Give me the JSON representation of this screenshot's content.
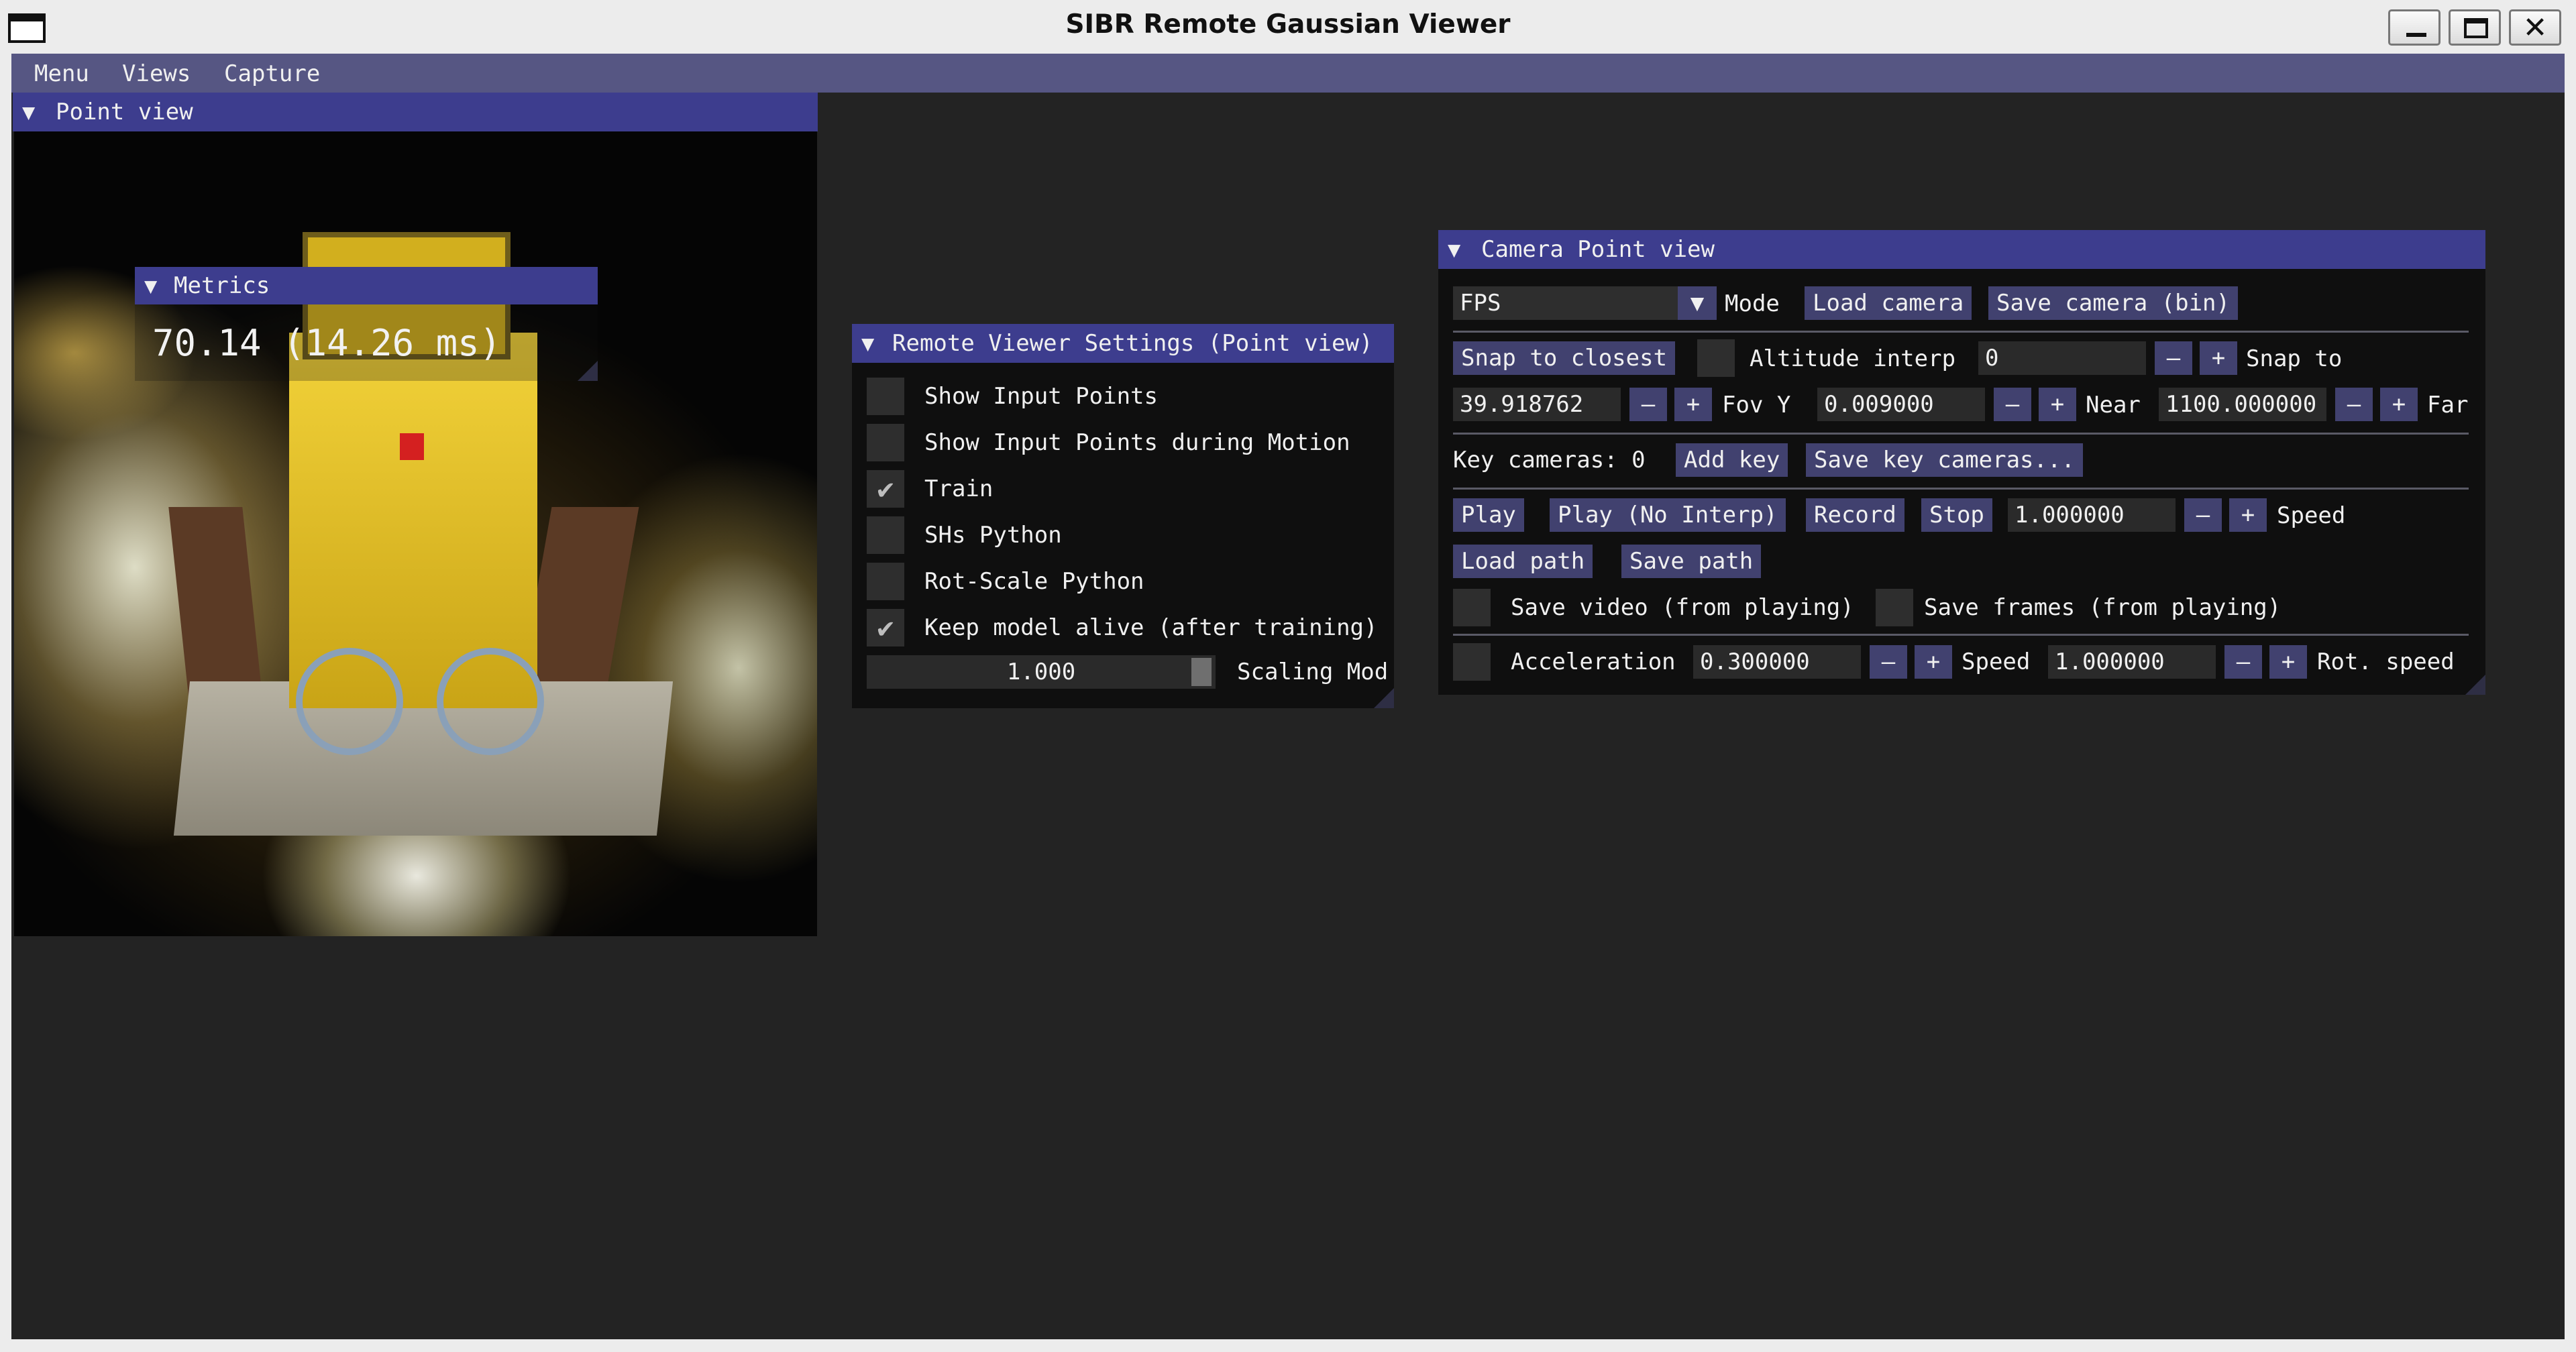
{
  "window": {
    "title": "SIBR Remote Gaussian Viewer"
  },
  "menubar": [
    "Menu",
    "Views",
    "Capture"
  ],
  "point_view": {
    "title": "Point view",
    "metrics": {
      "title": "Metrics",
      "value": "70.14 (14.26 ms)"
    }
  },
  "remote_settings": {
    "title": "Remote Viewer Settings (Point view)",
    "options": [
      {
        "label": "Show Input Points",
        "checked": false
      },
      {
        "label": "Show Input Points during Motion",
        "checked": false
      },
      {
        "label": "Train",
        "checked": true
      },
      {
        "label": "SHs Python",
        "checked": false
      },
      {
        "label": "Rot-Scale Python",
        "checked": false
      },
      {
        "label": "Keep model alive (after training)",
        "checked": true
      }
    ],
    "check_glyph": "✔",
    "scaling": {
      "value": "1.000",
      "label": "Scaling Mod",
      "fraction": 0.0
    }
  },
  "camera": {
    "title": "Camera Point view",
    "mode_value": "FPS",
    "mode_label": "Mode",
    "load_camera": "Load camera",
    "save_camera": "Save camera (bin)",
    "snap_closest": "Snap to closest",
    "altitude_interp_label": "Altitude interp",
    "altitude_value": "0",
    "snap_to_label": "Snap to",
    "fov_value": "39.918762",
    "fov_label": "Fov Y",
    "near_value": "0.009000",
    "near_label": "Near",
    "far_value": "1100.000000",
    "far_label": "Far",
    "key_cameras_label": "Key cameras: 0",
    "add_key": "Add key",
    "save_key_cameras": "Save key cameras...",
    "play": "Play",
    "play_no_interp": "Play (No Interp)",
    "record": "Record",
    "stop": "Stop",
    "speed_value": "1.000000",
    "speed_label": "Speed",
    "load_path": "Load path",
    "save_path": "Save path",
    "save_video": "Save video (from playing)",
    "save_frames": "Save frames (from playing)",
    "acceleration_label": "Acceleration",
    "acceleration_value": "0.300000",
    "move_speed_label": "Speed",
    "move_speed_value": "1.000000",
    "rot_speed_label": "Rot. speed",
    "minus": "–",
    "plus": "+"
  }
}
